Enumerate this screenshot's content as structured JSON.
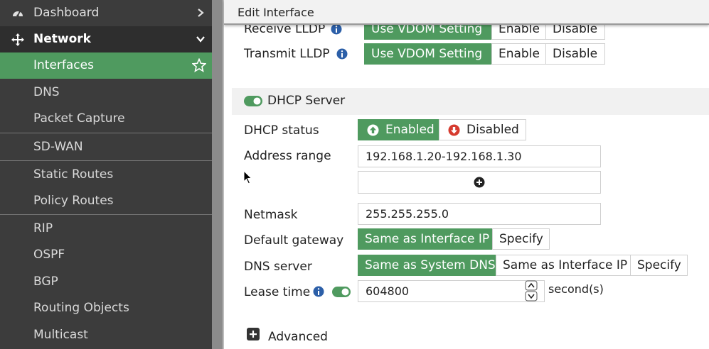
{
  "sidebar": {
    "items": [
      {
        "label": "Dashboard"
      },
      {
        "label": "Network"
      },
      {
        "label": "Interfaces"
      },
      {
        "label": "DNS"
      },
      {
        "label": "Packet Capture"
      },
      {
        "label": "SD-WAN"
      },
      {
        "label": "Static Routes"
      },
      {
        "label": "Policy Routes"
      },
      {
        "label": "RIP"
      },
      {
        "label": "OSPF"
      },
      {
        "label": "BGP"
      },
      {
        "label": "Routing Objects"
      },
      {
        "label": "Multicast"
      }
    ]
  },
  "dialog": {
    "title": "Edit Interface"
  },
  "lldp": {
    "receive_label": "Receive LLDP",
    "transmit_label": "Transmit LLDP",
    "options": [
      "Use VDOM Setting",
      "Enable",
      "Disable"
    ],
    "receive_selected": "Use VDOM Setting",
    "transmit_selected": "Use VDOM Setting"
  },
  "dhcp": {
    "section_title": "DHCP Server",
    "section_enabled": true,
    "status_label": "DHCP status",
    "status_enabled": "Enabled",
    "status_disabled": "Disabled",
    "address_range_label": "Address range",
    "address_range_value": "192.168.1.20-192.168.1.30",
    "netmask_label": "Netmask",
    "netmask_value": "255.255.255.0",
    "gateway_label": "Default gateway",
    "gateway_options": [
      "Same as Interface IP",
      "Specify"
    ],
    "dns_label": "DNS server",
    "dns_options": [
      "Same as System DNS",
      "Same as Interface IP",
      "Specify"
    ],
    "lease_label": "Lease time",
    "lease_value": "604800",
    "lease_unit": "second(s)",
    "advanced_label": "Advanced"
  },
  "colors": {
    "accent": "#4f9a5f",
    "sidebar_bg": "#3c3c3c",
    "section_bg": "#2e2e2e",
    "danger": "#d63b2f"
  },
  "icons": [
    "dashboard-icon",
    "move-icon",
    "chevron-right-icon",
    "chevron-down-icon",
    "star-icon",
    "info-icon",
    "toggle-icon",
    "up-circle-icon",
    "down-circle-icon",
    "plus-circle-icon",
    "spinner-icon",
    "plus-square-icon",
    "mouse-cursor-icon"
  ]
}
